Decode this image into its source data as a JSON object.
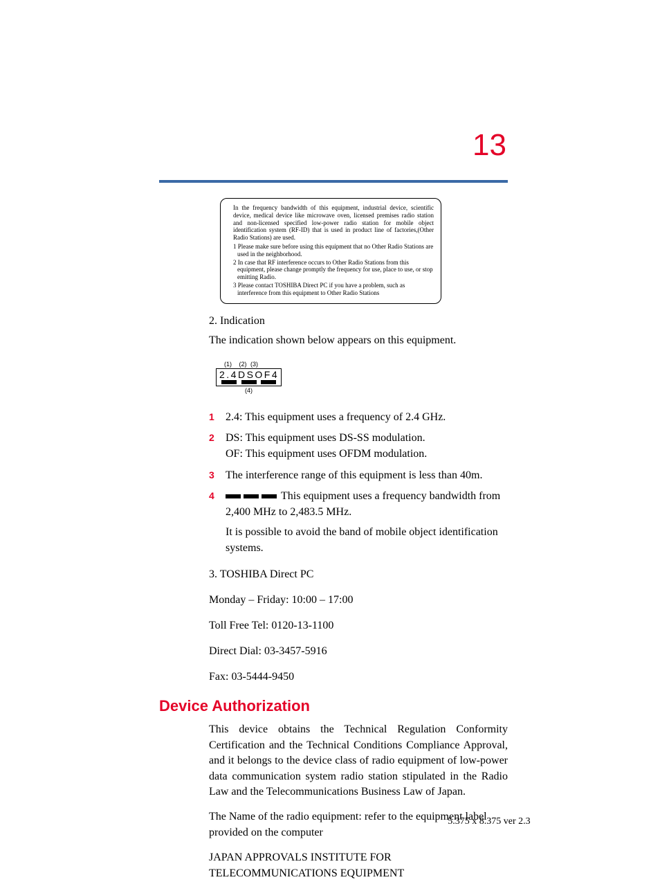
{
  "page_number": "13",
  "notice": {
    "intro": "In the frequency bandwidth of this equipment, industrial device, scientific device, medical device like microwave oven, licensed premises radio station and non-licensed specified low-power radio station for mobile object identification system (RF-ID) that is used in product line of factories,(Other Radio Stations) are used.",
    "p1": "1 Please make sure before using this equipment that no Other Radio Stations are used in the neighborhood.",
    "p2": "2 In case that RF interference occurs to Other Radio Stations from this equipment, please change promptly the frequency for use, place to use, or stop emitting Radio.",
    "p3": "3 Please contact TOSHIBA Direct PC if you have a problem, such as interference from this equipment to Other Radio Stations"
  },
  "indication_heading": "2. Indication",
  "indication_intro": "The indication shown below appears on this equipment.",
  "ind_label": {
    "t1": "(1)",
    "t2": "(2)",
    "t3": "(3)",
    "code": "2.4DSOF4",
    "b": "(4)"
  },
  "list": {
    "n1": "1",
    "t1": "2.4: This equipment uses a frequency of 2.4 GHz.",
    "n2": "2",
    "t2a": "DS: This equipment uses DS-SS modulation.",
    "t2b": "OF: This equipment uses OFDM modulation.",
    "n3": "3",
    "t3": "The interference range of this equipment is less than 40m.",
    "n4": "4",
    "t4a": "This equipment uses a frequency bandwidth from 2,400 MHz to 2,483.5 MHz.",
    "t4b": "It is possible to avoid the band of mobile object identification systems."
  },
  "contact": {
    "title": "3. TOSHIBA Direct PC",
    "hours": "Monday – Friday: 10:00 – 17:00",
    "tollfree": "Toll Free Tel: 0120-13-1100",
    "direct": "Direct Dial: 03-3457-5916",
    "fax": "Fax: 03-5444-9450"
  },
  "section_title": "Device Authorization",
  "body": {
    "p1": "This device obtains the Technical Regulation Conformity Certification and the Technical Conditions Compliance Approval, and it belongs to the device class of radio equipment of low-power data communication system radio station stipulated in the Radio Law and the Telecommunications Business Law of Japan.",
    "p2": "The Name of the radio equipment: refer to the equipment label provided on the computer",
    "p3": "JAPAN APPROVALS INSTITUTE FOR TELECOMMUNICATIONS EQUIPMENT"
  },
  "footer": "5.375 x 8.375 ver 2.3"
}
